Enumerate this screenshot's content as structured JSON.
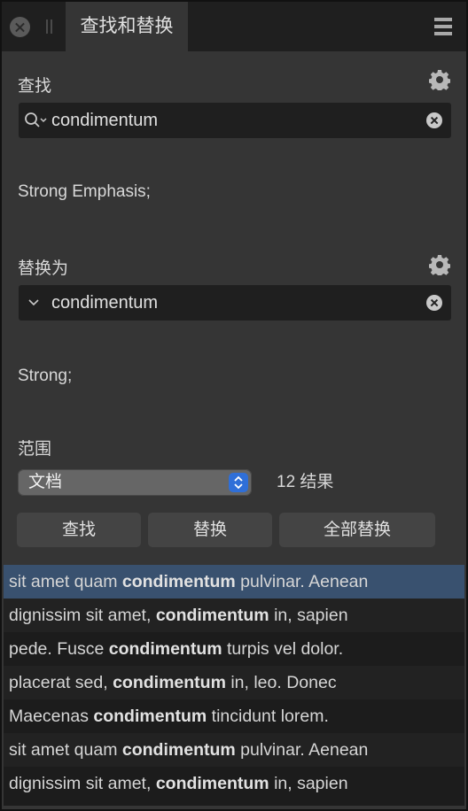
{
  "tab": {
    "title": "查找和替换"
  },
  "find": {
    "label": "查找",
    "value": "condimentum",
    "style": "Strong Emphasis;"
  },
  "replace": {
    "label": "替换为",
    "value": "condimentum",
    "style": "Strong;"
  },
  "scope": {
    "label": "范围",
    "selected": "文档",
    "results_count": "12 结果"
  },
  "buttons": {
    "find": "查找",
    "replace": "替换",
    "replace_all": "全部替换"
  },
  "results": [
    {
      "before": "sit amet quam ",
      "match": "condimentum",
      "after": " pulvinar. Aenean",
      "selected": true
    },
    {
      "before": "dignissim sit amet, ",
      "match": "condimentum",
      "after": " in, sapien"
    },
    {
      "before": "pede. Fusce ",
      "match": "condimentum",
      "after": " turpis vel dolor."
    },
    {
      "before": "placerat sed, ",
      "match": "condimentum",
      "after": " in, leo. Donec"
    },
    {
      "before": "Maecenas ",
      "match": "condimentum",
      "after": " tincidunt lorem."
    },
    {
      "before": "sit amet quam ",
      "match": "condimentum",
      "after": " pulvinar. Aenean"
    },
    {
      "before": "dignissim sit amet, ",
      "match": "condimentum",
      "after": " in, sapien"
    }
  ],
  "colors": {
    "selection": "#39516f",
    "stepper_accent": "#2f6fd8"
  }
}
